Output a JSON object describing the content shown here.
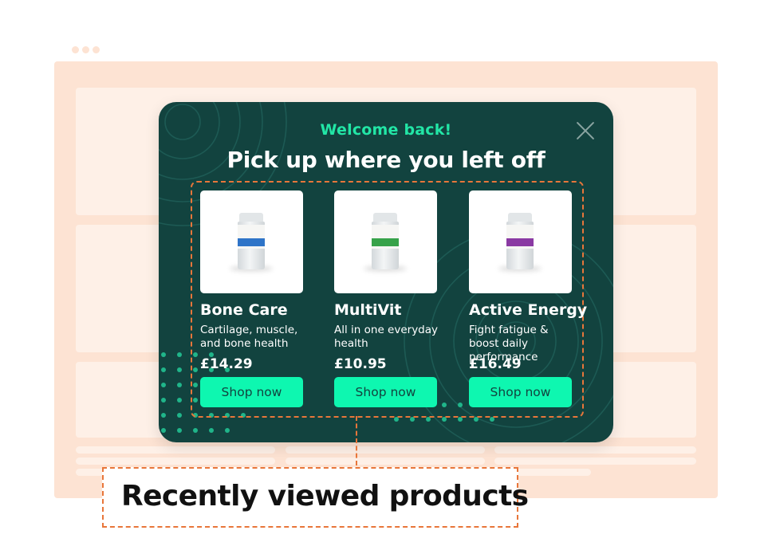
{
  "modal": {
    "eyebrow": "Welcome back!",
    "headline": "Pick up where you left off",
    "close_icon": "close-icon",
    "products": [
      {
        "name": "Bone Care",
        "description": "Cartilage, muscle, and bone health",
        "price": "£14.29",
        "cta": "Shop now",
        "label_color": "#2f74c8"
      },
      {
        "name": "MultiVit",
        "description": "All in one everyday health",
        "price": "£10.95",
        "cta": "Shop now",
        "label_color": "#37a24a"
      },
      {
        "name": "Active Energy",
        "description": "Fight fatigue & boost daily performance",
        "price": "£16.49",
        "cta": "Shop now",
        "label_color": "#8a3aa3"
      }
    ]
  },
  "annotation": {
    "label": "Recently viewed products"
  },
  "colors": {
    "modal_bg": "#12433f",
    "accent": "#22e6a6",
    "button": "#0ef7b0",
    "highlight": "#e8763a",
    "page_bg": "#fde3d3"
  }
}
